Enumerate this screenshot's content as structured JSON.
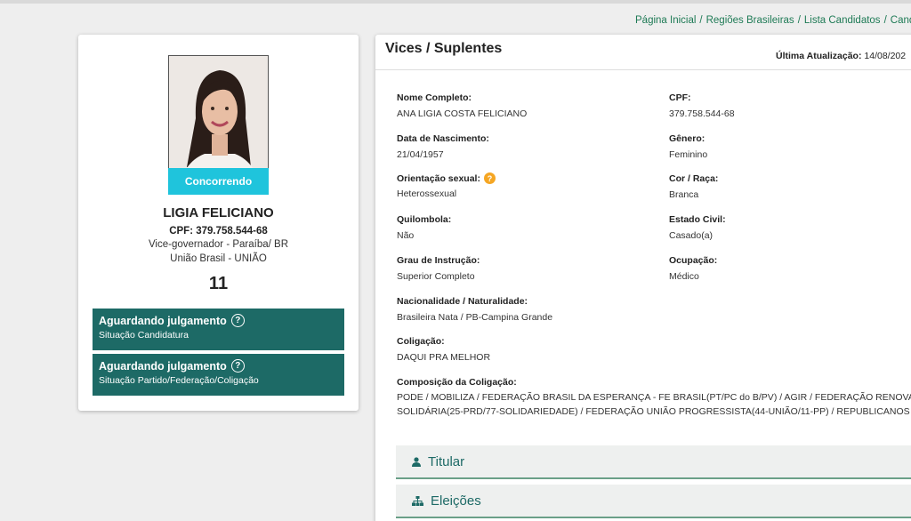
{
  "breadcrumb": {
    "items": [
      "Página Inicial",
      "Regiões Brasileiras",
      "Lista Candidatos",
      "Cand"
    ]
  },
  "candidate": {
    "status_tag": "Concorrendo",
    "name": "LIGIA FELICIANO",
    "cpf": "CPF: 379.758.544-68",
    "cargo": "Vice-governador - Paraíba/ BR",
    "party": "União Brasil - UNIÃO",
    "number": "11",
    "situations": [
      {
        "title": "Aguardando julgamento",
        "subtitle": "Situação Candidatura"
      },
      {
        "title": "Aguardando julgamento",
        "subtitle": "Situação Partido/Federação/Coligação"
      }
    ]
  },
  "panel": {
    "title": "Vices / Suplentes",
    "update_label": "Última Atualização:",
    "update_value": "14/08/202",
    "fields": {
      "nome_label": "Nome Completo:",
      "nome_value": "ANA LIGIA COSTA FELICIANO",
      "cpf_label": "CPF:",
      "cpf_value": "379.758.544-68",
      "nasc_label": "Data de Nascimento:",
      "nasc_value": "21/04/1957",
      "genero_label": "Gênero:",
      "genero_value": "Feminino",
      "orient_label": "Orientação sexual:",
      "orient_value": "Heterossexual",
      "cor_label": "Cor / Raça:",
      "cor_value": "Branca",
      "quilombola_label": "Quilombola:",
      "quilombola_value": "Não",
      "civil_label": "Estado Civil:",
      "civil_value": "Casado(a)",
      "grau_label": "Grau de Instrução:",
      "grau_value": "Superior Completo",
      "ocup_label": "Ocupação:",
      "ocup_value": "Médico",
      "nac_label": "Nacionalidade / Naturalidade:",
      "nac_value": "Brasileira Nata / PB-Campina Grande",
      "colig_label": "Coligação:",
      "colig_value": "DAQUI PRA MELHOR",
      "comp_label": "Composição da Coligação:",
      "comp_line1": "PODE / MOBILIZA / FEDERAÇÃO BRASIL DA ESPERANÇA - FE BRASIL(PT/PC do B/PV) / AGIR / FEDERAÇÃO RENOVAÇ",
      "comp_line2": "SOLIDÁRIA(25-PRD/77-SOLIDARIEDADE) / FEDERAÇÃO UNIÃO PROGRESSISTA(44-UNIÃO/11-PP) / REPUBLICANOS / P"
    },
    "accordions": [
      "Titular",
      "Eleições"
    ]
  },
  "colors": {
    "accent_green": "#1d6a66",
    "link_green": "#1e7a55",
    "status_cyan": "#1fc4dc",
    "help_orange": "#f5a623"
  },
  "icons": {
    "help": "question-circle-icon",
    "user": "user-icon",
    "sitemap": "sitemap-icon"
  }
}
